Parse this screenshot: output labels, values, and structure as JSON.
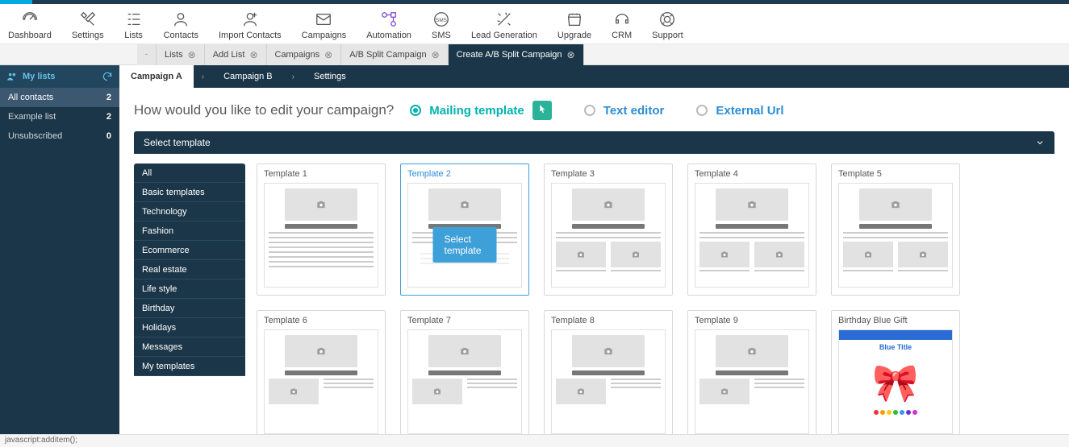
{
  "topnav": [
    {
      "id": "dashboard",
      "label": "Dashboard",
      "icon": "gauge"
    },
    {
      "id": "settings",
      "label": "Settings",
      "icon": "tools"
    },
    {
      "id": "lists",
      "label": "Lists",
      "icon": "lists"
    },
    {
      "id": "contacts",
      "label": "Contacts",
      "icon": "user"
    },
    {
      "id": "import",
      "label": "Import Contacts",
      "icon": "import"
    },
    {
      "id": "campaigns",
      "label": "Campaigns",
      "icon": "mail"
    },
    {
      "id": "automation",
      "label": "Automation",
      "icon": "automation",
      "accent": true
    },
    {
      "id": "sms",
      "label": "SMS",
      "icon": "sms"
    },
    {
      "id": "leadgen",
      "label": "Lead Generation",
      "icon": "wand"
    },
    {
      "id": "upgrade",
      "label": "Upgrade",
      "icon": "shop"
    },
    {
      "id": "crm",
      "label": "CRM",
      "icon": "headset"
    },
    {
      "id": "support",
      "label": "Support",
      "icon": "lifering"
    }
  ],
  "tabs": [
    {
      "label": "",
      "icon": true
    },
    {
      "label": "Lists",
      "closable": true
    },
    {
      "label": "Add List",
      "closable": true
    },
    {
      "label": "Campaigns",
      "closable": true
    },
    {
      "label": "A/B Split Campaign",
      "closable": true
    },
    {
      "label": "Create A/B Split Campaign",
      "closable": true,
      "active": true
    }
  ],
  "sidebar": {
    "title": "My lists",
    "items": [
      {
        "label": "All contacts",
        "count": "2",
        "active": true
      },
      {
        "label": "Example list",
        "count": "2"
      },
      {
        "label": "Unsubscribed",
        "count": "0"
      }
    ]
  },
  "wizard": [
    {
      "label": "Campaign A",
      "active": true
    },
    {
      "label": "Campaign B"
    },
    {
      "label": "Settings"
    }
  ],
  "question": "How would you like to edit your campaign?",
  "edit_options": [
    {
      "label": "Mailing template",
      "selected": true,
      "cls": "clr-teal"
    },
    {
      "label": "Text editor",
      "cls": "clr-blue"
    },
    {
      "label": "External Url",
      "cls": "clr-blue"
    }
  ],
  "select_bar": "Select template",
  "categories": [
    "All",
    "Basic templates",
    "Technology",
    "Fashion",
    "Ecommerce",
    "Real estate",
    "Life style",
    "Birthday",
    "Holidays",
    "Messages",
    "My templates"
  ],
  "templates_row1": [
    {
      "title": "Template 1",
      "variant": "a"
    },
    {
      "title": "Template 2",
      "variant": "b",
      "selected": true,
      "btn": "Select template"
    },
    {
      "title": "Template 3",
      "variant": "c"
    },
    {
      "title": "Template 4",
      "variant": "c"
    },
    {
      "title": "Template 5",
      "variant": "c"
    }
  ],
  "templates_row2": [
    {
      "title": "Template 6",
      "variant": "d"
    },
    {
      "title": "Template 7",
      "variant": "d"
    },
    {
      "title": "Template 8",
      "variant": "d"
    },
    {
      "title": "Template 9",
      "variant": "d"
    },
    {
      "title": "Birthday Blue Gift",
      "variant": "gift"
    }
  ],
  "statusbar": "javascript:additem();"
}
